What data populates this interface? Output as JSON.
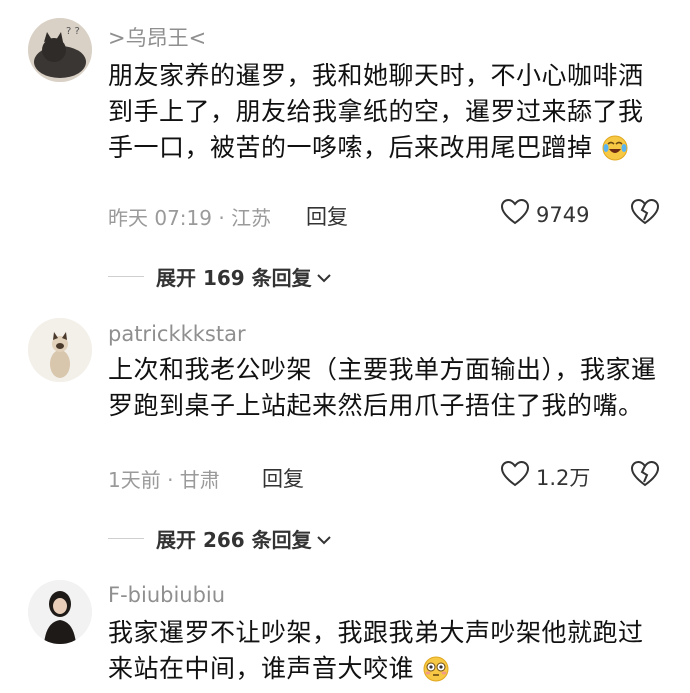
{
  "comments": [
    {
      "username": ">乌昂王<",
      "text": "朋友家养的暹罗，我和她聊天时，不小心咖啡洒到手上了，朋友给我拿纸的空，暹罗过来舔了我手一口，被苦的一哆嗦，后来改用尾巴蹭掉",
      "emoji": "crying-laughing-emoji",
      "time_location": "昨天 07:19 · 江苏",
      "reply_label": "回复",
      "like_count": "9749",
      "expand_label": "展开 169 条回复"
    },
    {
      "username": "patrickkkstar",
      "text": "上次和我老公吵架（主要我单方面输出），我家暹罗跑到桌子上站起来然后用爪子捂住了我的嘴。",
      "time_location": "1天前 · 甘肃",
      "reply_label": "回复",
      "like_count": "1.2万",
      "expand_label": "展开 266 条回复"
    },
    {
      "username": "F-biubiubiu",
      "text": "我家暹罗不让吵架，我跟我弟大声吵架他就跑过来站在中间，谁声音大咬谁",
      "emoji": "flushed-face-emoji"
    }
  ]
}
